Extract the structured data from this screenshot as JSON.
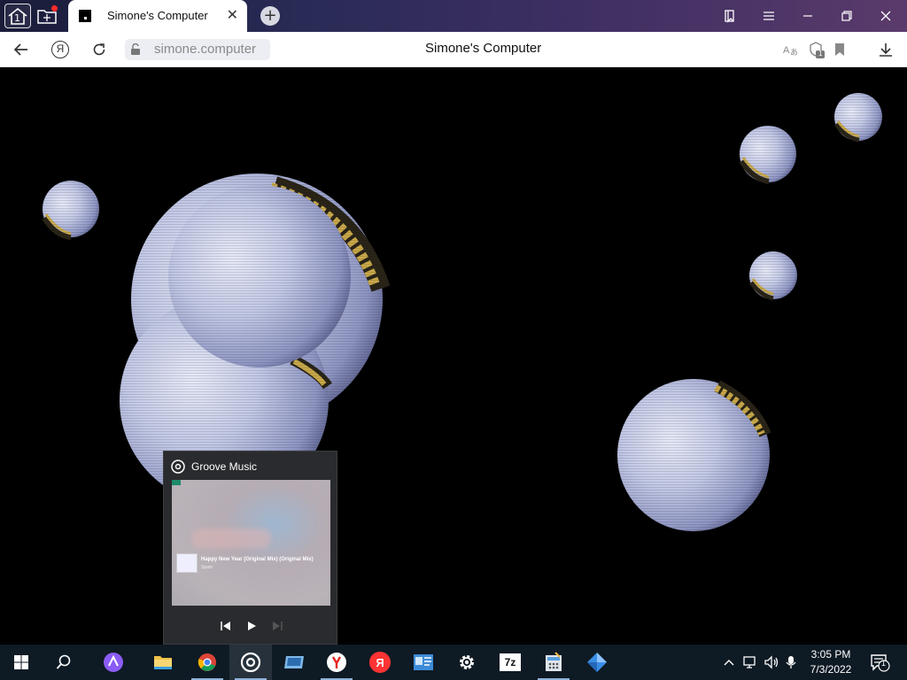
{
  "browser": {
    "tab_title": "Simone's Computer",
    "home_badge": "1",
    "url": "simone.computer",
    "page_title": "Simone's Computer",
    "yandex_letter": "Я",
    "bookmark_badge": "1"
  },
  "groove_thumbnail": {
    "app_name": "Groove Music",
    "song_title": "Happy New Year (Original Mix) (Original Mix)",
    "artist": "Spam"
  },
  "taskbar": {
    "pinned": [
      "start-button",
      "search-button",
      "alice-assistant",
      "file-explorer",
      "chrome",
      "groove-music",
      "app-window",
      "yandex-browser",
      "yandex",
      "contacts-app",
      "settings",
      "7zip",
      "calculator-app",
      "blue-diamond-app"
    ],
    "zip_label": "7z",
    "yandex_letter": "Я",
    "clock_time": "3:05 PM",
    "clock_date": "7/3/2022",
    "notification_count": "1"
  },
  "colors": {
    "titlebar_start": "#1a1c3a",
    "titlebar_end": "#5a3a6b",
    "taskbar": "#0e1a24",
    "sphere": "#c5cbe6",
    "sphere_accent": "#c9a94a"
  }
}
